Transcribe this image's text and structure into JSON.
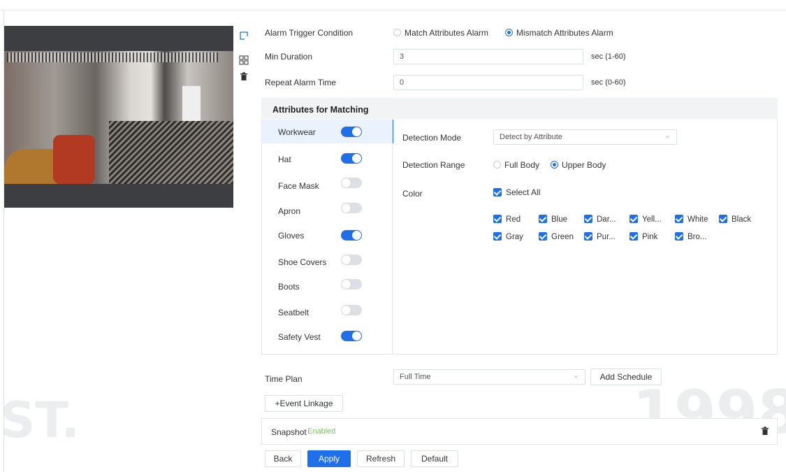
{
  "toolbar": {
    "draw_icon": "draw-rule-icon",
    "grid_icon": "grid-icon",
    "delete_icon": "trash-icon"
  },
  "alarm_trigger": {
    "label": "Alarm Trigger Condition",
    "options": [
      "Match Attributes Alarm",
      "Mismatch Attributes Alarm"
    ],
    "selected": "Mismatch Attributes Alarm"
  },
  "min_duration": {
    "label": "Min Duration",
    "value": "3",
    "unit": "sec (1-60)"
  },
  "repeat_alarm": {
    "label": "Repeat Alarm Time",
    "value": "0",
    "unit": "sec (0-60)"
  },
  "attributes": {
    "title": "Attributes for Matching",
    "items": [
      {
        "label": "Workwear",
        "on": true
      },
      {
        "label": "Hat",
        "on": true
      },
      {
        "label": "Face Mask",
        "on": false
      },
      {
        "label": "Apron",
        "on": false
      },
      {
        "label": "Gloves",
        "on": true
      },
      {
        "label": "Shoe Covers",
        "on": false
      },
      {
        "label": "Boots",
        "on": false
      },
      {
        "label": "Seatbelt",
        "on": false
      },
      {
        "label": "Safety Vest",
        "on": true
      }
    ]
  },
  "detection": {
    "mode_label": "Detection Mode",
    "mode_value": "Detect by Attribute",
    "range_label": "Detection Range",
    "range_options": [
      "Full Body",
      "Upper Body"
    ],
    "range_selected": "Upper Body",
    "color_label": "Color",
    "select_all": "Select All",
    "colors": [
      "Red",
      "Blue",
      "Dar...",
      "Yell...",
      "White",
      "Black",
      "Gray",
      "Green",
      "Pur...",
      "Pink",
      "Bro..."
    ]
  },
  "time_plan": {
    "label": "Time Plan",
    "value": "Full Time",
    "add_button": "Add Schedule"
  },
  "event_linkage": {
    "button": "+Event Linkage"
  },
  "snapshot": {
    "label": "Snapshot",
    "status": "Enabled"
  },
  "footer": {
    "back": "Back",
    "apply": "Apply",
    "refresh": "Refresh",
    "default": "Default"
  },
  "colors": {
    "accent": "#1e6fe8",
    "enabled_text": "#7cc068"
  }
}
